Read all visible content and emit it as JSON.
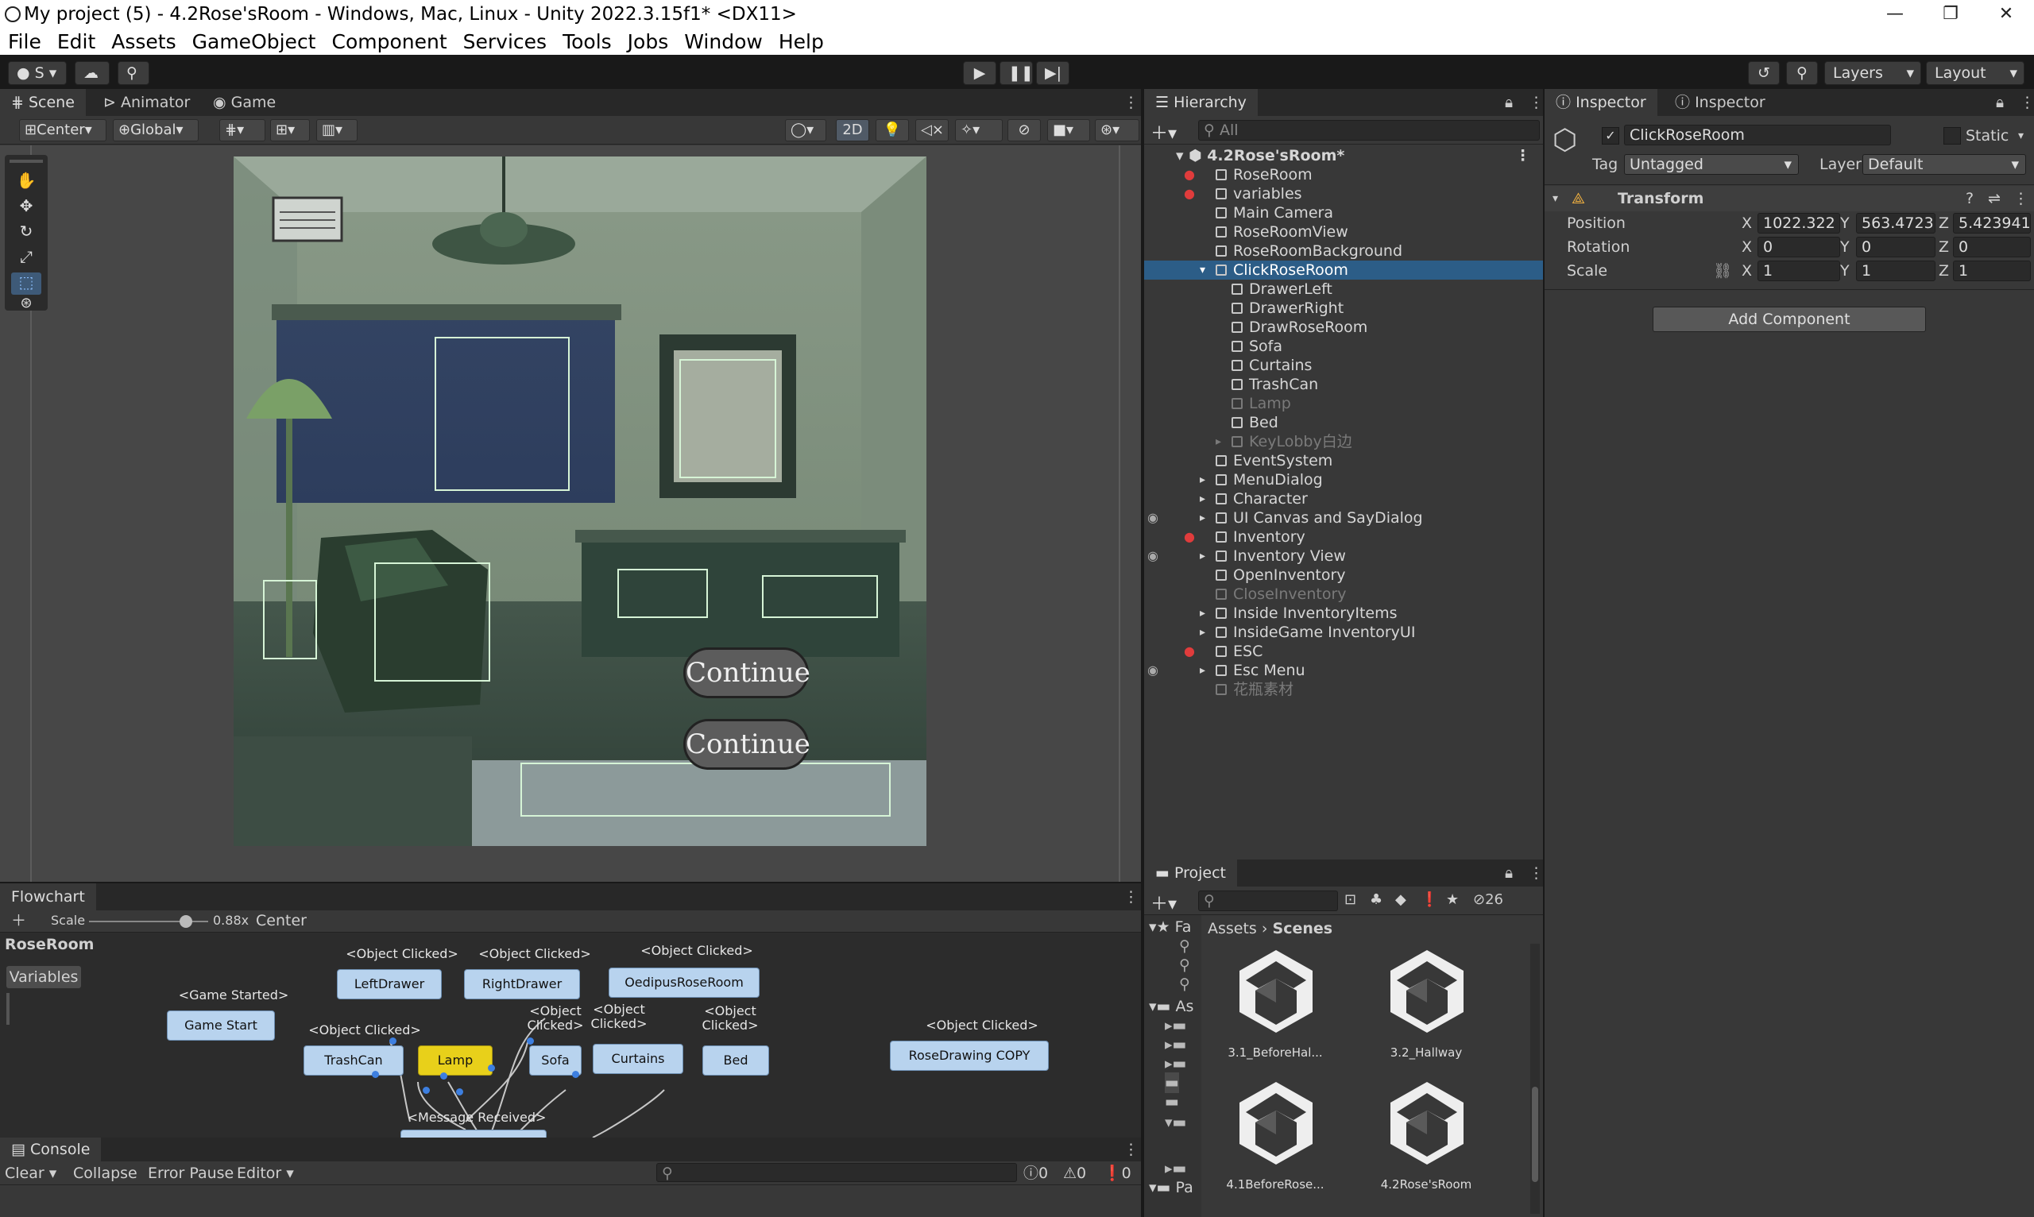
{
  "window": {
    "title": "My project (5) - 4.2Rose'sRoom - Windows, Mac, Linux - Unity 2022.3.15f1* <DX11>",
    "controls": [
      "—",
      "❐",
      "✕"
    ]
  },
  "menu": [
    "File",
    "Edit",
    "Assets",
    "GameObject",
    "Component",
    "Services",
    "Tools",
    "Jobs",
    "Window",
    "Help"
  ],
  "toolbar": {
    "account": "S",
    "layers_label": "Layers",
    "layout_label": "Layout"
  },
  "scene": {
    "tabs": [
      "Scene",
      "Animator",
      "Game"
    ],
    "pivot": "Center",
    "space": "Global",
    "mode_2d": "2D",
    "buttons": [
      "Continue",
      "Continue"
    ]
  },
  "hierarchy": {
    "title": "Hierarchy",
    "search_placeholder": "All",
    "scene_name": "4.2Rose'sRoom*",
    "items": [
      {
        "label": "RoseRoom",
        "indent": 1,
        "dim": false,
        "icon": "red"
      },
      {
        "label": "variables",
        "indent": 1,
        "dim": false,
        "icon": "red"
      },
      {
        "label": "Main Camera",
        "indent": 1,
        "dim": false
      },
      {
        "label": "RoseRoomView",
        "indent": 1,
        "dim": false
      },
      {
        "label": "RoseRoomBackground",
        "indent": 1,
        "dim": false
      },
      {
        "label": "ClickRoseRoom",
        "indent": 1,
        "dim": false,
        "selected": true,
        "expanded": true
      },
      {
        "label": "DrawerLeft",
        "indent": 2,
        "dim": false
      },
      {
        "label": "DrawerRight",
        "indent": 2,
        "dim": false
      },
      {
        "label": "DrawRoseRoom",
        "indent": 2,
        "dim": false
      },
      {
        "label": "Sofa",
        "indent": 2,
        "dim": false
      },
      {
        "label": "Curtains",
        "indent": 2,
        "dim": false
      },
      {
        "label": "TrashCan",
        "indent": 2,
        "dim": false
      },
      {
        "label": "Lamp",
        "indent": 2,
        "dim": true
      },
      {
        "label": "Bed",
        "indent": 2,
        "dim": false
      },
      {
        "label": "KeyLobby白边",
        "indent": 2,
        "dim": true,
        "collapsed": true
      },
      {
        "label": "EventSystem",
        "indent": 1,
        "dim": false
      },
      {
        "label": "MenuDialog",
        "indent": 1,
        "dim": false,
        "collapsed": true
      },
      {
        "label": "Character",
        "indent": 1,
        "dim": false,
        "collapsed": true
      },
      {
        "label": "UI Canvas and SayDialog",
        "indent": 1,
        "dim": false,
        "collapsed": true,
        "eye": true
      },
      {
        "label": "Inventory",
        "indent": 1,
        "dim": false,
        "icon": "red"
      },
      {
        "label": "Inventory View",
        "indent": 1,
        "dim": false,
        "collapsed": true,
        "eye": true
      },
      {
        "label": "OpenInventory",
        "indent": 1,
        "dim": false
      },
      {
        "label": "CloseInventory",
        "indent": 1,
        "dim": true
      },
      {
        "label": "Inside InventoryItems",
        "indent": 1,
        "dim": false,
        "collapsed": true
      },
      {
        "label": "InsideGame InventoryUI",
        "indent": 1,
        "dim": false,
        "collapsed": true
      },
      {
        "label": "ESC",
        "indent": 1,
        "dim": false,
        "icon": "red"
      },
      {
        "label": "Esc Menu",
        "indent": 1,
        "dim": false,
        "collapsed": true,
        "eye": true
      },
      {
        "label": "花瓶素材",
        "indent": 1,
        "dim": true
      }
    ]
  },
  "inspector": {
    "tabs": [
      "Inspector",
      "Inspector"
    ],
    "object_name": "ClickRoseRoom",
    "static_label": "Static",
    "tag_label": "Tag",
    "tag_value": "Untagged",
    "layer_label": "Layer",
    "layer_value": "Default",
    "transform_label": "Transform",
    "position_label": "Position",
    "rotation_label": "Rotation",
    "scale_label": "Scale",
    "position": {
      "x": "1022.322",
      "y": "563.4723",
      "z": "5.423941"
    },
    "rotation": {
      "x": "0",
      "y": "0",
      "z": "0"
    },
    "scale": {
      "x": "1",
      "y": "1",
      "z": "1"
    },
    "add_component": "Add Component"
  },
  "project": {
    "title": "Project",
    "count": "26",
    "breadcrumb": [
      "Assets",
      "Scenes"
    ],
    "tree_labels": [
      "Fa",
      "As",
      "Pa"
    ],
    "assets": [
      "3.1_BeforeHal...",
      "3.2_Hallway",
      "4.1BeforeRose...",
      "4.2Rose'sRoom"
    ]
  },
  "flowchart": {
    "title": "Flowchart",
    "scale_label": "Scale",
    "scale_value": "0.88x",
    "center_label": "Center",
    "name": "RoseRoom",
    "variables_label": "Variables",
    "nodes": [
      {
        "caption": "<Game Started>",
        "label": "Game Start",
        "highlight": false
      },
      {
        "caption": "<Object Clicked>",
        "label": "LeftDrawer",
        "highlight": false
      },
      {
        "caption": "<Object Clicked>",
        "label": "RightDrawer",
        "highlight": false
      },
      {
        "caption": "<Object Clicked>",
        "label": "OedipusRoseRoom",
        "highlight": false
      },
      {
        "caption": "<Object Clicked>",
        "label": "TrashCan",
        "highlight": false
      },
      {
        "caption": "",
        "label": "Lamp",
        "highlight": true
      },
      {
        "caption": "<Object Clicked>",
        "label": "Sofa",
        "highlight": false
      },
      {
        "caption": "<Object Clicked>",
        "label": "Curtains",
        "highlight": false
      },
      {
        "caption": "<Object Clicked>",
        "label": "Bed",
        "highlight": false
      },
      {
        "caption": "<Object Clicked>",
        "label": "RoseDrawing COPY",
        "highlight": false
      },
      {
        "caption": "<Message Received>",
        "label": "",
        "highlight": false
      }
    ]
  },
  "console": {
    "title": "Console",
    "clear_label": "Clear",
    "collapse_label": "Collapse",
    "error_pause_label": "Error Pause",
    "editor_label": "Editor",
    "counts": [
      "0",
      "0",
      "0"
    ]
  }
}
